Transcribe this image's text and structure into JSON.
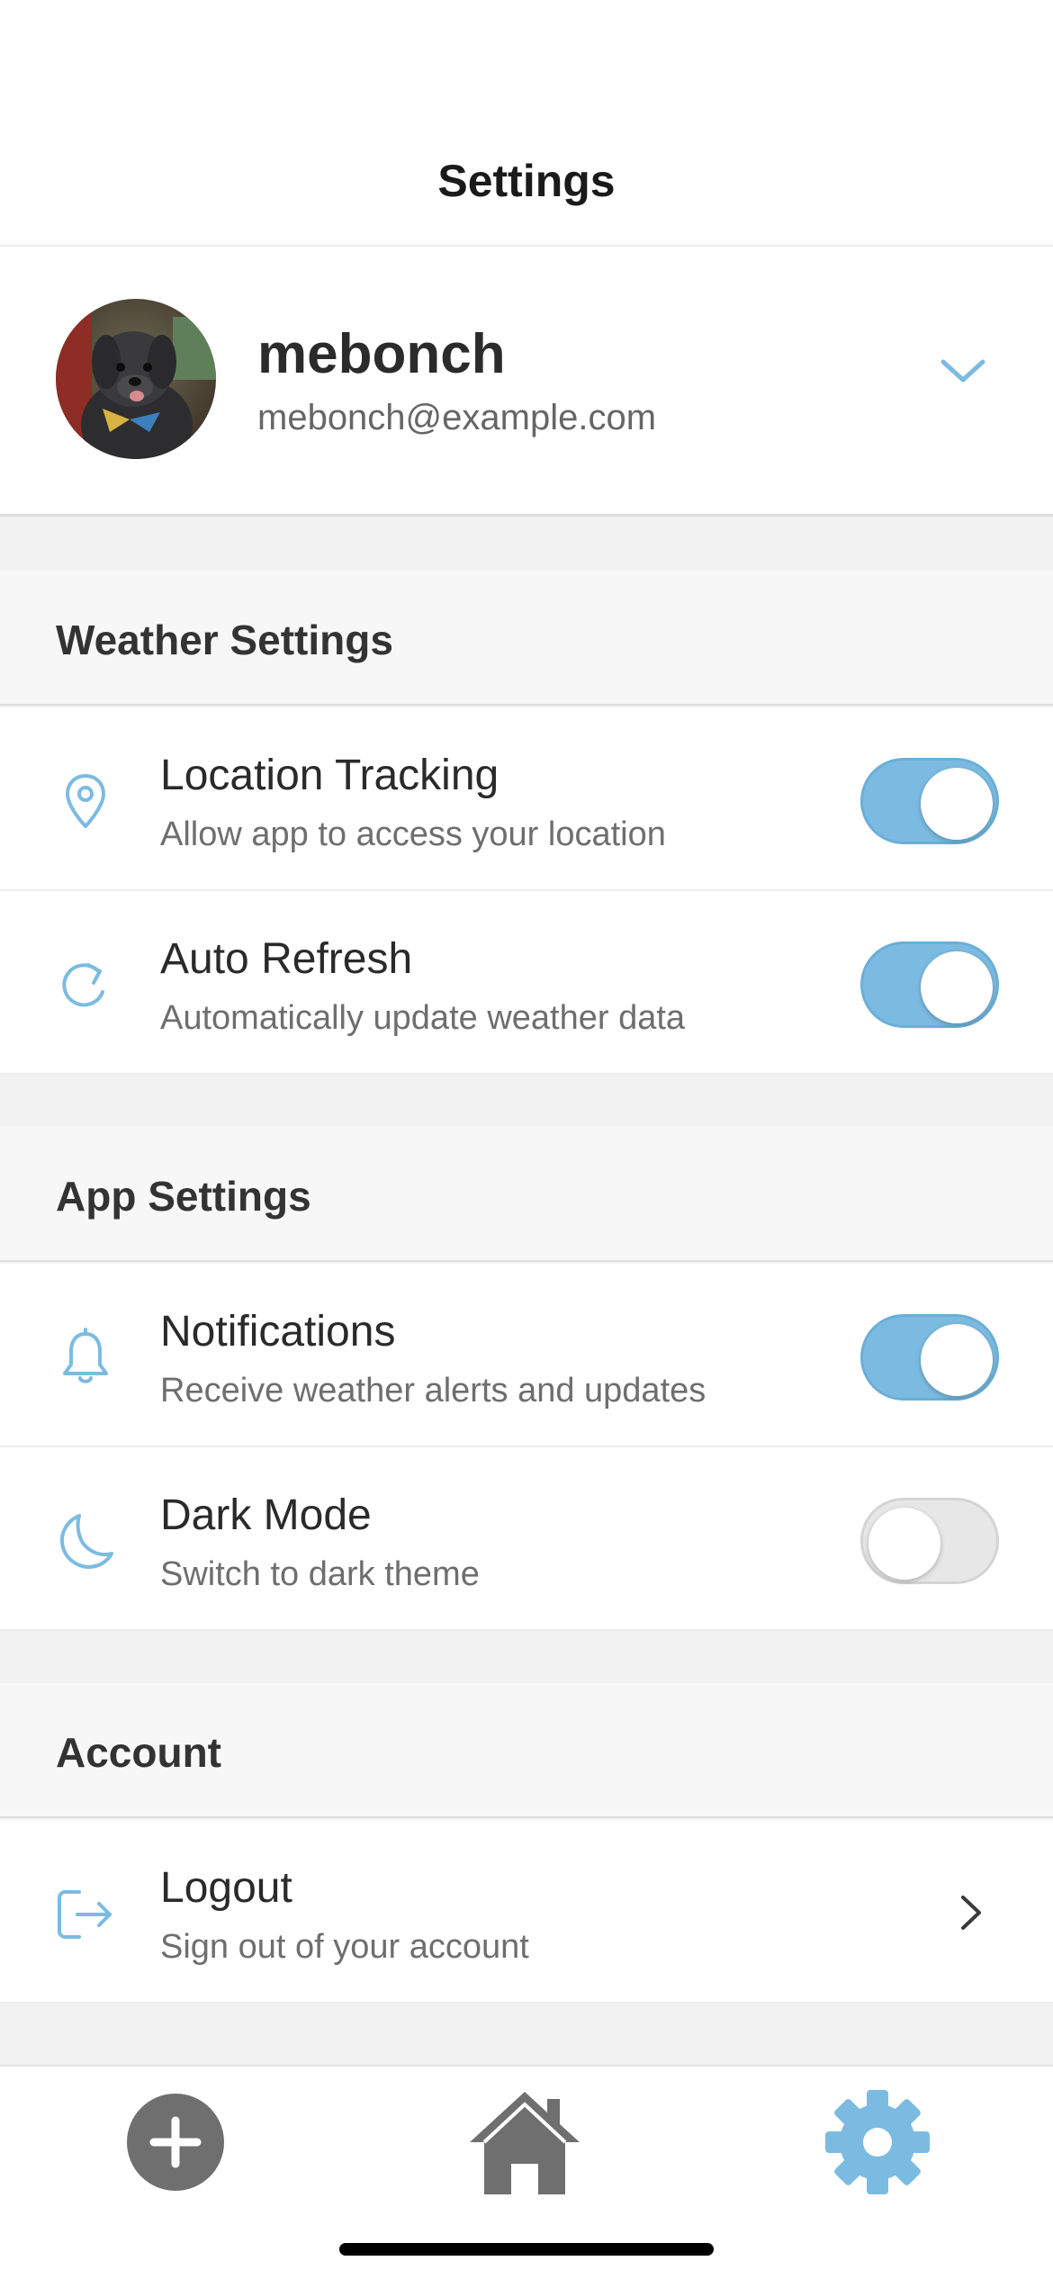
{
  "header": {
    "title": "Settings"
  },
  "profile": {
    "name": "mebonch",
    "email": "mebonch@example.com",
    "avatar_icon": "dog-avatar-photo",
    "expand_icon": "chevron-down-icon"
  },
  "sections": [
    {
      "title": "Weather Settings",
      "items": [
        {
          "title": "Location Tracking",
          "subtitle": "Allow app to access your location",
          "icon": "location-pin-icon",
          "enabled": true
        },
        {
          "title": "Auto Refresh",
          "subtitle": "Automatically update weather data",
          "icon": "refresh-icon",
          "enabled": true
        }
      ]
    },
    {
      "title": "App Settings",
      "items": [
        {
          "title": "Notifications",
          "subtitle": "Receive weather alerts and updates",
          "icon": "bell-icon",
          "enabled": true
        },
        {
          "title": "Dark Mode",
          "subtitle": "Switch to dark theme",
          "icon": "moon-icon",
          "enabled": false
        }
      ]
    },
    {
      "title": "Account",
      "items": [
        {
          "title": "Logout",
          "subtitle": "Sign out of your account",
          "icon": "logout-icon"
        }
      ]
    }
  ],
  "tabbar": {
    "tabs": [
      {
        "name": "add",
        "icon": "plus-circle-icon",
        "active": false
      },
      {
        "name": "home",
        "icon": "home-icon",
        "active": false
      },
      {
        "name": "settings",
        "icon": "gear-icon",
        "active": true
      }
    ]
  },
  "colors": {
    "accent": "#7cbbe1",
    "toggle_off": "#e7e7e7",
    "tab_inactive": "#7a7a7a"
  }
}
